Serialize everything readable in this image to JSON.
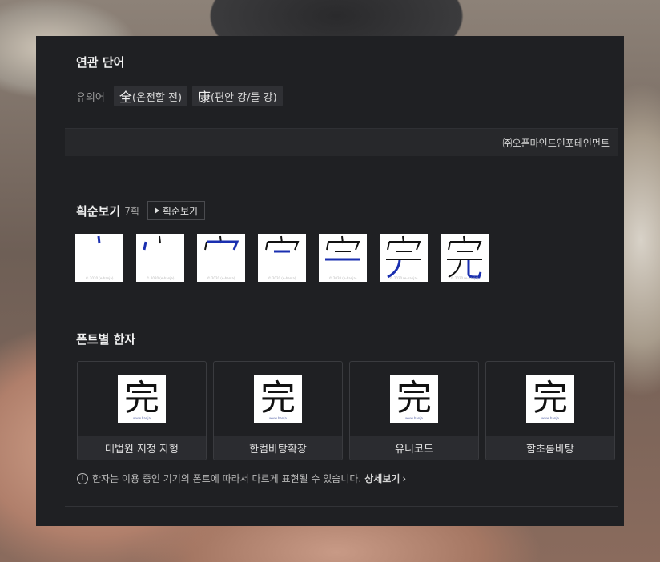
{
  "related": {
    "title": "연관 단어",
    "synonym_label": "유의어",
    "synonyms": [
      {
        "han": "全",
        "reading": "(온전할 전)"
      },
      {
        "han": "康",
        "reading": "(편안 강/들 강)"
      }
    ],
    "source": "㈜오픈마인드인포테인먼트"
  },
  "stroke": {
    "title": "획순보기",
    "count": "7획",
    "play_label": "획순보기",
    "watermark": "© 2020 (e-hanja)"
  },
  "fonts": {
    "title": "폰트별 한자",
    "glyph": "完",
    "mark": "www.hanja",
    "items": [
      {
        "label": "대법원 지정 자형"
      },
      {
        "label": "한컴바탕확장"
      },
      {
        "label": "유니코드"
      },
      {
        "label": "함초롬바탕"
      }
    ],
    "notice": "한자는 이용 중인 기기의 폰트에 따라서 다르게 표현될 수 있습니다.",
    "more_label": "상세보기"
  },
  "colors": {
    "panel_bg": "#1f2023",
    "stroke_highlight": "#1a2fb0"
  },
  "icons": {
    "info": "info-circle-icon",
    "play": "play-icon",
    "chevron": "chevron-right-icon"
  }
}
